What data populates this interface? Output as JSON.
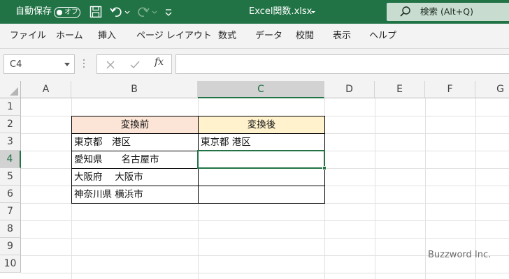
{
  "titlebar": {
    "autosave_label": "自動保存",
    "autosave_state": "オフ",
    "filename": "Excel関数.xlsx",
    "search_text": "検索 (Alt+Q)",
    "accent_color": "#217346"
  },
  "menu": {
    "items": [
      "ファイル",
      "ホーム",
      "挿入",
      "ページ レイアウト",
      "数式",
      "データ",
      "校閲",
      "表示",
      "ヘルプ"
    ]
  },
  "formula_bar": {
    "name_box": "C4",
    "fx_label": "fx",
    "formula": ""
  },
  "sheet": {
    "columns": [
      "A",
      "B",
      "C",
      "D",
      "E",
      "F",
      "G"
    ],
    "rows": [
      "1",
      "2",
      "3",
      "4",
      "5",
      "6",
      "7",
      "8",
      "9",
      "10"
    ],
    "active_column": "C",
    "active_row": "4",
    "active_cell": "C4",
    "header_before": "変換前",
    "header_after": "変換後",
    "before_values": [
      "東京都　港区",
      "愛知県　　名古屋市",
      "大阪府　 大阪市",
      "神奈川県 横浜市"
    ],
    "after_values": [
      "東京都 港区",
      "",
      "",
      ""
    ],
    "header_before_color": "#fce4d6",
    "header_after_color": "#fff2cc"
  },
  "watermark": "Buzzword Inc."
}
